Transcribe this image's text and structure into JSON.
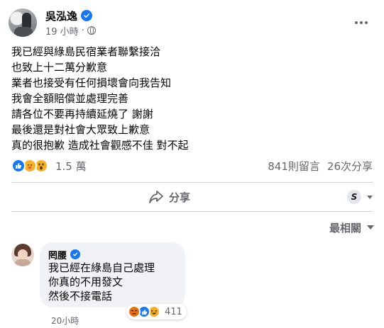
{
  "post": {
    "author_name": "吳泓逸",
    "timestamp": "19 小時",
    "separator": "·",
    "lines": [
      "我已經與綠島民宿業者聯繫接洽",
      "也致上十二萬分歉意",
      "業者也接受有任何損壞會向我告知",
      "我會全額賠償並處理完善",
      "請各位不要再持續延燒了 謝謝",
      "最後還是對社會大眾致上歉意",
      "真的很抱歉 造成社會觀感不佳 對不起"
    ]
  },
  "stats": {
    "reaction_count": "1.5 萬",
    "comments": "841則留言",
    "shares": "26次分享"
  },
  "actions": {
    "share_label": "分享",
    "audience_letter": "S"
  },
  "sort": {
    "label": "最相關"
  },
  "comment": {
    "author_name": "罔腰",
    "lines": [
      "我已經在綠島自己處理",
      "你真的不用發文",
      "然後不接電話"
    ],
    "reaction_count": "411",
    "time": "20小時"
  },
  "colors": {
    "brand_blue": "#1877f2",
    "secondary_text": "#65676b",
    "bubble_bg": "#f0f2f5"
  }
}
